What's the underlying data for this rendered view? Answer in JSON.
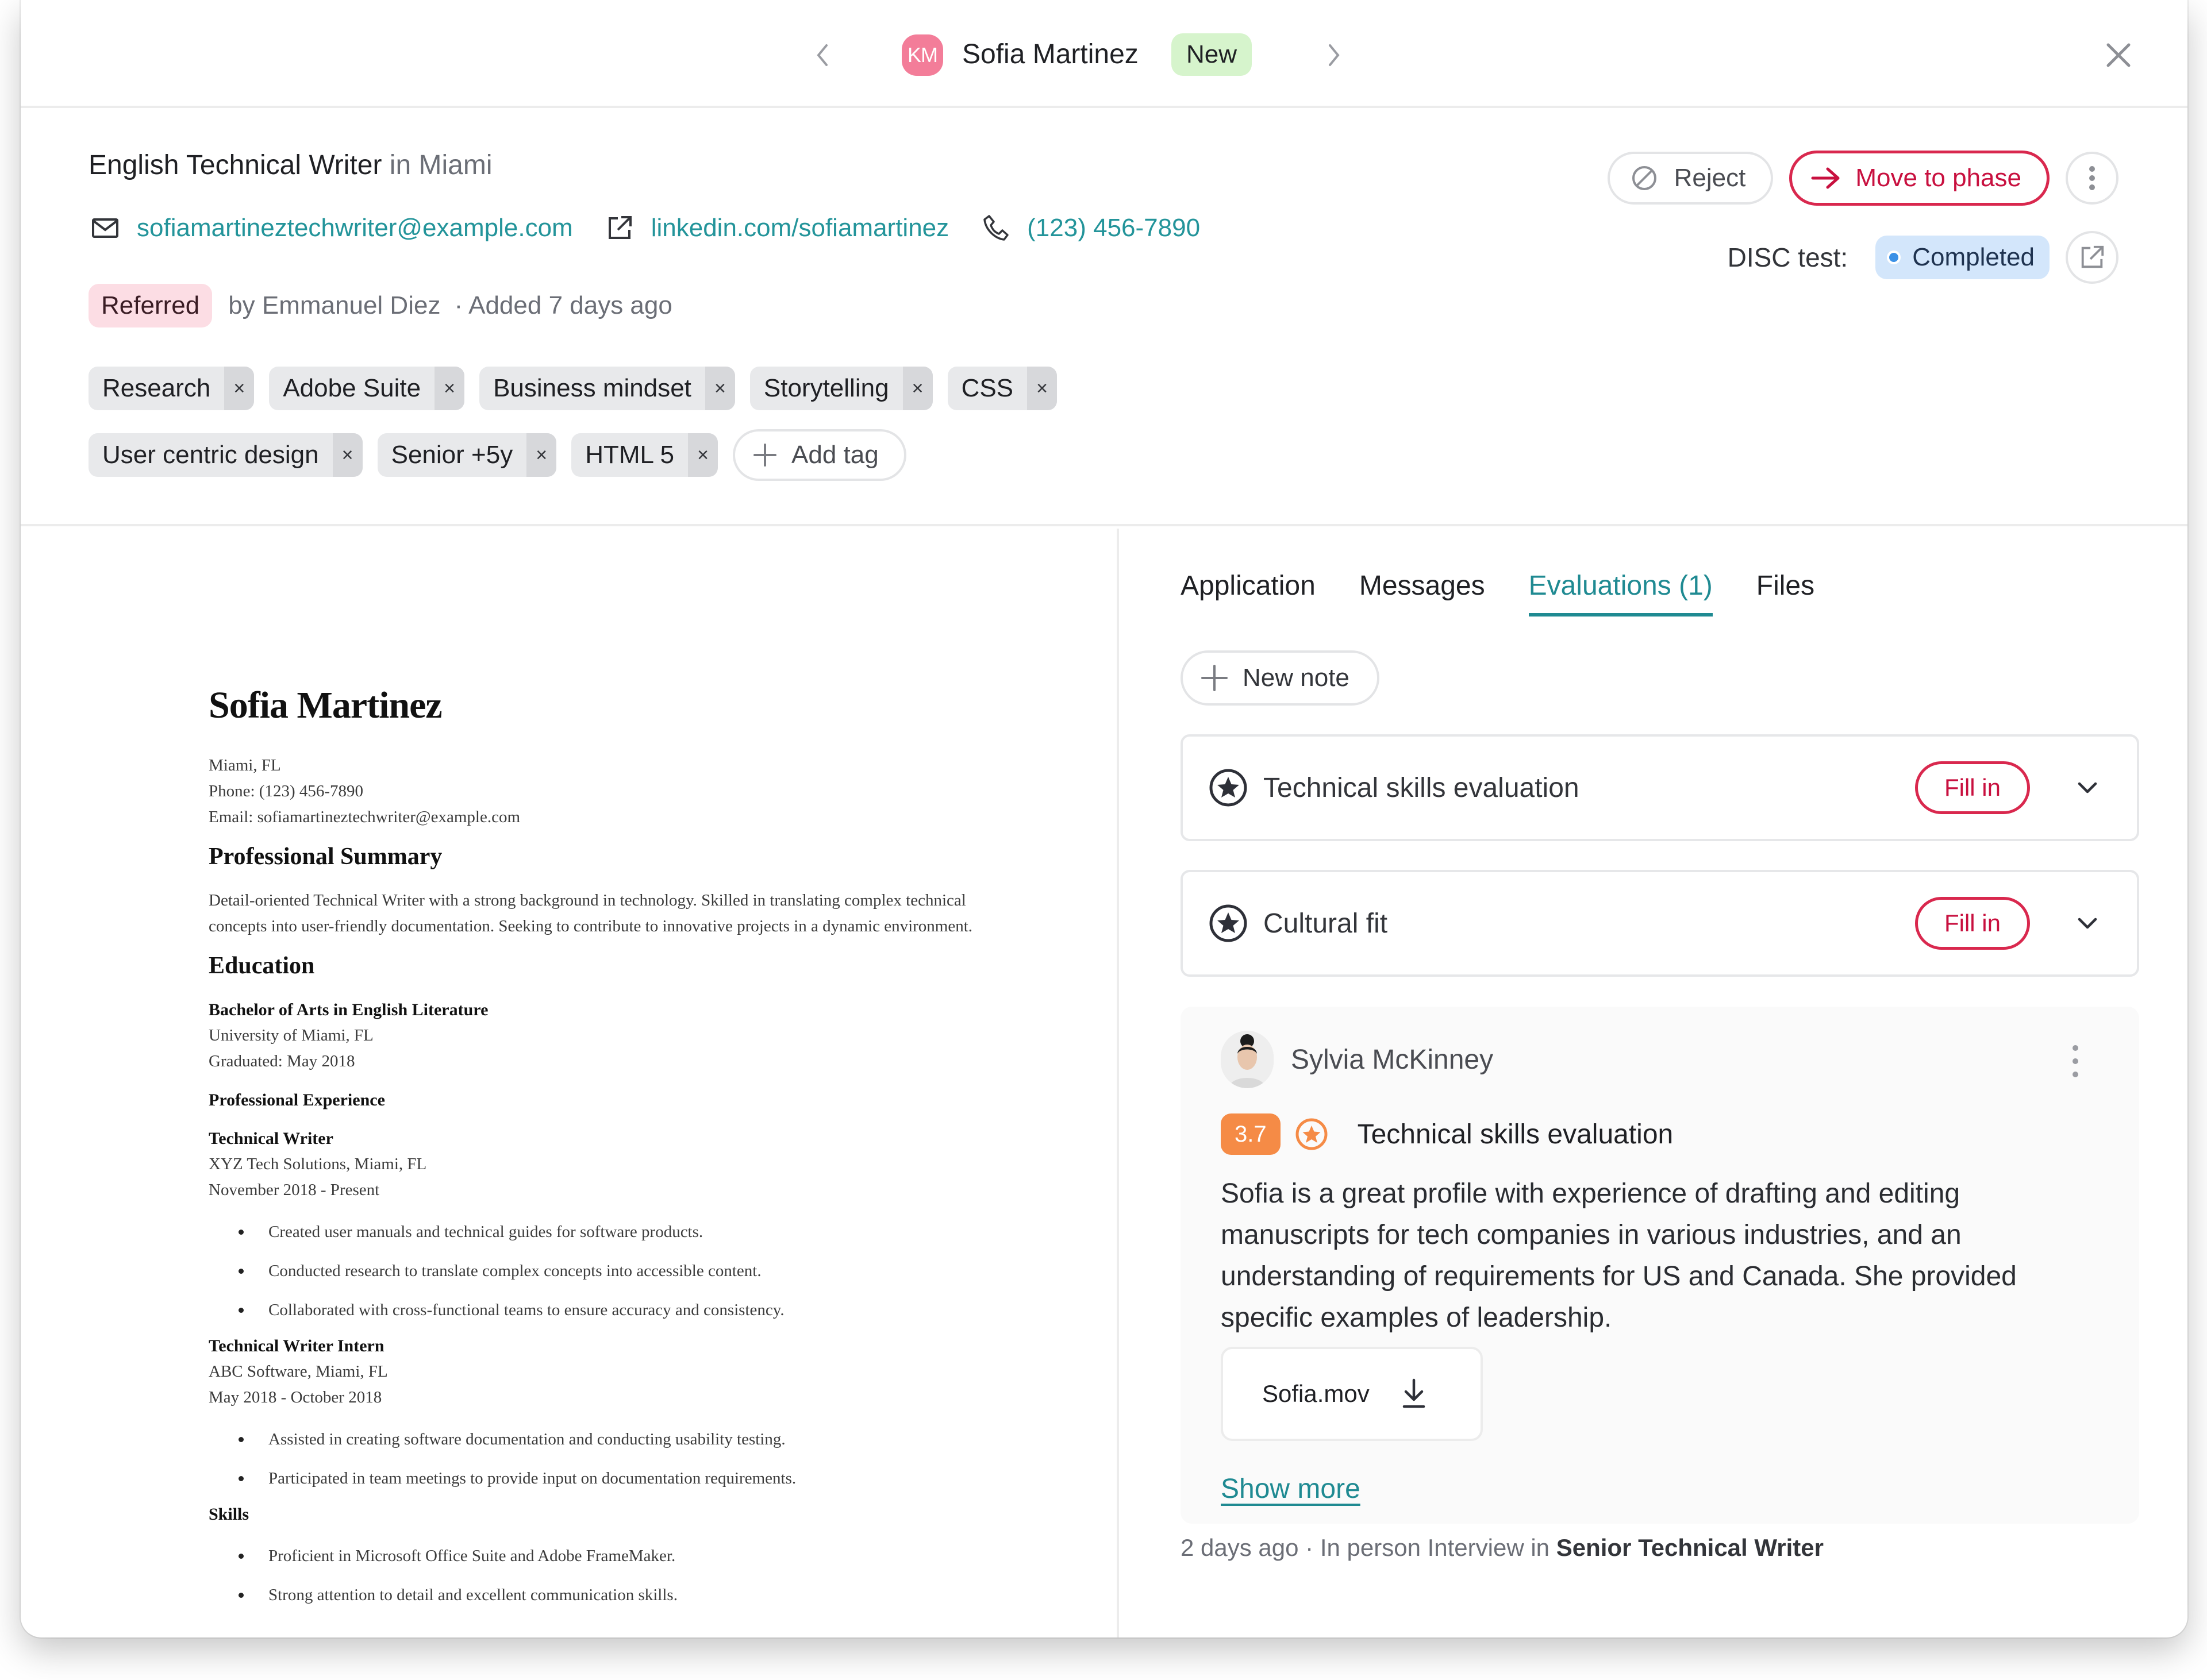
{
  "topbar": {
    "candidate_initials": "KM",
    "candidate_name": "Sofia Martinez",
    "status_badge": "New",
    "avatar_color": "#f37d99",
    "badge_color": "#d6f4cc"
  },
  "header": {
    "job_title": "English Technical Writer",
    "job_location_prefix": "in",
    "job_location": "Miami",
    "email": "sofiamartineztechwriter@example.com",
    "linkedin": "linkedin.com/sofiamartinez",
    "phone": "(123) 456-7890",
    "source_badge": "Referred",
    "referred_by": "by Emmanuel Diez",
    "added": "Added 7 days ago",
    "separator": "·",
    "tags_row1": [
      "Research",
      "Adobe Suite",
      "Business mindset",
      "Storytelling",
      "CSS"
    ],
    "tags_row2": [
      "User centric design",
      "Senior +5y",
      "HTML 5"
    ],
    "tag_remove": "×",
    "add_tag_label": "Add tag",
    "reject_label": "Reject",
    "move_label": "Move to phase",
    "disc_label": "DISC test:",
    "disc_status": "Completed",
    "accent_color": "#d9284e",
    "link_color": "#23949a"
  },
  "resume": {
    "name": "Sofia Martinez",
    "location": "Miami, FL",
    "phone": "Phone: (123) 456-7890",
    "email": "Email: sofiamartineztechwriter@example.com",
    "summary_heading": "Professional Summary",
    "summary": "Detail-oriented Technical Writer with a strong background in technology. Skilled in translating complex technical concepts into user-friendly documentation. Seeking to contribute to innovative projects in a dynamic environment.",
    "education_heading": "Education",
    "degree": "Bachelor of Arts in English Literature",
    "university": "University of Miami, FL",
    "graduated": "Graduated: May 2018",
    "experience_heading": "Professional Experience",
    "job1_title": "Technical Writer",
    "job1_company": "XYZ Tech Solutions, Miami, FL",
    "job1_dates": "November 2018 - Present",
    "job1_bullets": [
      "Created user manuals and technical guides for software products.",
      "Conducted research to translate complex concepts into accessible content.",
      "Collaborated with cross-functional teams to ensure accuracy and consistency."
    ],
    "job2_title": "Technical Writer Intern",
    "job2_company": "ABC Software, Miami, FL",
    "job2_dates": "May 2018 - October 2018",
    "job2_bullets": [
      "Assisted in creating software documentation and conducting usability testing.",
      "Participated in team meetings to provide input on documentation requirements."
    ],
    "skills_heading": "Skills",
    "skills": [
      "Proficient in Microsoft Office Suite and Adobe FrameMaker.",
      "Strong attention to detail and excellent communication skills."
    ]
  },
  "panel": {
    "tabs": [
      {
        "label": "Application",
        "active": false
      },
      {
        "label": "Messages",
        "active": false
      },
      {
        "label": "Evaluations (1)",
        "active": true
      },
      {
        "label": "Files",
        "active": false
      }
    ],
    "new_note_label": "New note",
    "evaluations": [
      {
        "title": "Technical skills evaluation",
        "action": "Fill in"
      },
      {
        "title": "Cultural fit",
        "action": "Fill in"
      }
    ],
    "note": {
      "author": "Sylvia McKinney",
      "score": "3.7",
      "score_color": "#f58b46",
      "evaluation_title": "Technical skills evaluation",
      "body": "Sofia is a great profile with experience of drafting and editing manuscripts for tech companies in various industries, and an understanding of requirements for US and Canada. She provided specific examples of leadership.",
      "attachment": "Sofia.mov",
      "show_more": "Show more",
      "footer_time": "2 days ago",
      "footer_context": "· In person Interview in",
      "footer_job": "Senior Technical Writer"
    }
  }
}
